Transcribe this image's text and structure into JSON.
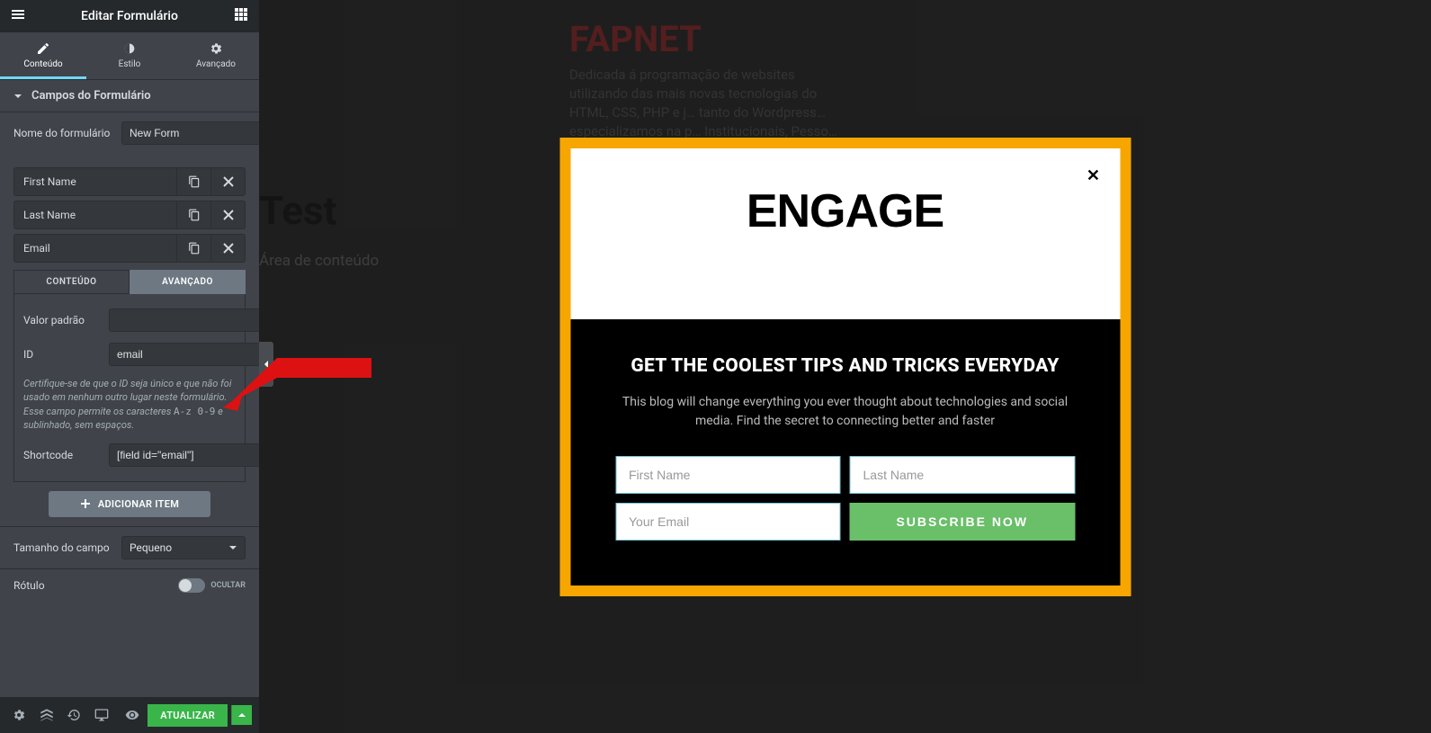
{
  "header": {
    "title": "Editar Formulário"
  },
  "tabs": {
    "content": "Conteúdo",
    "style": "Estilo",
    "advanced": "Avançado"
  },
  "section": {
    "form_fields": "Campos do Formulário"
  },
  "controls": {
    "form_name_label": "Nome do formulário",
    "form_name_value": "New Form"
  },
  "fields": [
    {
      "label": "First Name"
    },
    {
      "label": "Last Name"
    },
    {
      "label": "Email"
    }
  ],
  "sub_tabs": {
    "content": "CONTEÚDO",
    "advanced": "AVANÇADO"
  },
  "field_adv": {
    "default_label": "Valor padrão",
    "default_value": "",
    "id_label": "ID",
    "id_value": "email",
    "help_line1": "Certifique-se de que o ID seja único e que não foi usado em nenhum outro lugar neste formulário. Esse campo permite os caracteres ",
    "help_mono": "A-z 0-9",
    "help_line2": " e sublinhado, sem espaços.",
    "shortcode_label": "Shortcode",
    "shortcode_value": "[field id=\"email\"]"
  },
  "add_item": "ADICIONAR ITEM",
  "field_size": {
    "label": "Tamanho do campo",
    "value": "Pequeno"
  },
  "rotulo": {
    "label": "Rótulo",
    "state": "OCULTAR"
  },
  "footer": {
    "update": "ATUALIZAR"
  },
  "page": {
    "fapnet_title": "FAPNET",
    "fapnet_desc": "Dedicada á programação de websites utilizando das mais novas tecnologias do HTML, CSS, PHP e j… tanto do Wordpress… especializamos na p… Institucionais, Pesso… (eCommerce), Blogs… nele…",
    "test_heading": "Test",
    "area": "Área de conteúdo"
  },
  "popup": {
    "logo": "ENGAGE",
    "heading": "GET THE COOLEST TIPS AND TRICKS EVERYDAY",
    "desc": "This blog will change everything you ever thought about technologies and social media. Find the secret to connecting better and faster",
    "first_name_ph": "First Name",
    "last_name_ph": "Last Name",
    "email_ph": "Your Email",
    "submit": "SUBSCRIBE NOW"
  }
}
